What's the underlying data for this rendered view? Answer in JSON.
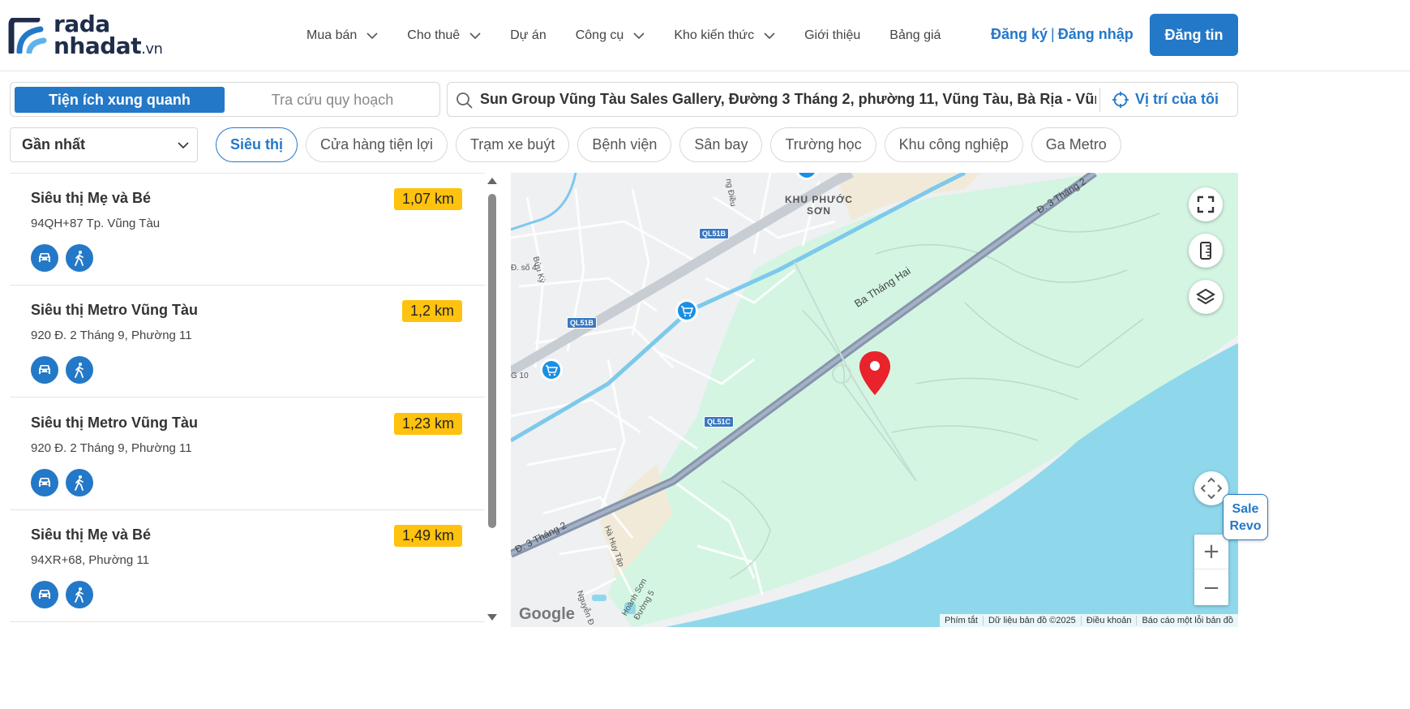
{
  "logo": {
    "line1": "rada",
    "line2": "nhadat",
    "suffix": ".vn"
  },
  "nav": [
    {
      "label": "Mua bán",
      "dropdown": true
    },
    {
      "label": "Cho thuê",
      "dropdown": true
    },
    {
      "label": "Dự án",
      "dropdown": false
    },
    {
      "label": "Công cụ",
      "dropdown": true
    },
    {
      "label": "Kho kiến thức",
      "dropdown": true
    },
    {
      "label": "Giới thiệu",
      "dropdown": false
    },
    {
      "label": "Bảng giá",
      "dropdown": false
    }
  ],
  "auth": {
    "register": "Đăng ký",
    "separator": "|",
    "login": "Đăng nhập"
  },
  "post_button": "Đăng tin",
  "mode_tabs": {
    "active": "Tiện ích xung quanh",
    "inactive": "Tra cứu quy hoạch"
  },
  "search": {
    "value": "Sun Group Vũng Tàu Sales Gallery, Đường 3 Tháng 2, phường 11, Vũng Tàu, Bà Rịa - Vũng Tàu",
    "my_location": "Vị trí của tôi"
  },
  "sort": {
    "selected": "Gần nhất"
  },
  "categories": [
    {
      "label": "Siêu thị",
      "active": true
    },
    {
      "label": "Cửa hàng tiện lợi",
      "active": false
    },
    {
      "label": "Trạm xe buýt",
      "active": false
    },
    {
      "label": "Bệnh viện",
      "active": false
    },
    {
      "label": "Sân bay",
      "active": false
    },
    {
      "label": "Trường học",
      "active": false
    },
    {
      "label": "Khu công nghiệp",
      "active": false
    },
    {
      "label": "Ga Metro",
      "active": false
    }
  ],
  "results": [
    {
      "name": "Siêu thị Mẹ và Bé",
      "address": "94QH+87 Tp. Vũng Tàu",
      "distance": "1,07 km"
    },
    {
      "name": "Siêu thị Metro Vũng Tàu",
      "address": "920 Đ. 2 Tháng 9, Phường 11",
      "distance": "1,2 km"
    },
    {
      "name": "Siêu thị Metro Vũng Tàu",
      "address": "920 Đ. 2 Tháng 9, Phường 11",
      "distance": "1,23 km"
    },
    {
      "name": "Siêu thị Mẹ và Bé",
      "address": "94XR+68, Phường 11",
      "distance": "1,49 km"
    }
  ],
  "map": {
    "labels": {
      "district_1": "KHU PHƯỚC",
      "district_2": "SƠN",
      "road_ba_thang_hai": "Ba Tháng Hai",
      "road_d3_top": "Đ. 3 Tháng 2",
      "road_d3_bottom": "Đ. 3 Tháng 2",
      "road_so4": "Đ. số 4",
      "road_buu_ky": "Bửu Kỳ",
      "road_g10": "G 10",
      "road_ha_huy_tap": "Hà Huy Tập",
      "road_hoanh_son": "Hoành Sơn",
      "road_duong5": "Đường 5",
      "road_nguyen": "Nguyễn Đ",
      "road_dieu": "ng Điều"
    },
    "shields": {
      "ql51b_1": "QL51B",
      "ql51b_2": "QL51B",
      "ql51c": "QL51C"
    },
    "google": "Google",
    "footer": [
      "Phím tắt",
      "Dữ liệu bản đồ ©2025",
      "Điều khoản",
      "Báo cáo một lỗi bản đồ"
    ],
    "zoom_in": "+",
    "zoom_out": "−"
  },
  "sale_revo": {
    "line1": "Sale",
    "line2": "Revo"
  },
  "colors": {
    "primary": "#2478c8",
    "distance_badge": "#ffc20e",
    "sea": "#8fd8ec",
    "park": "#d3f5e2",
    "pin": "#e8232b"
  }
}
